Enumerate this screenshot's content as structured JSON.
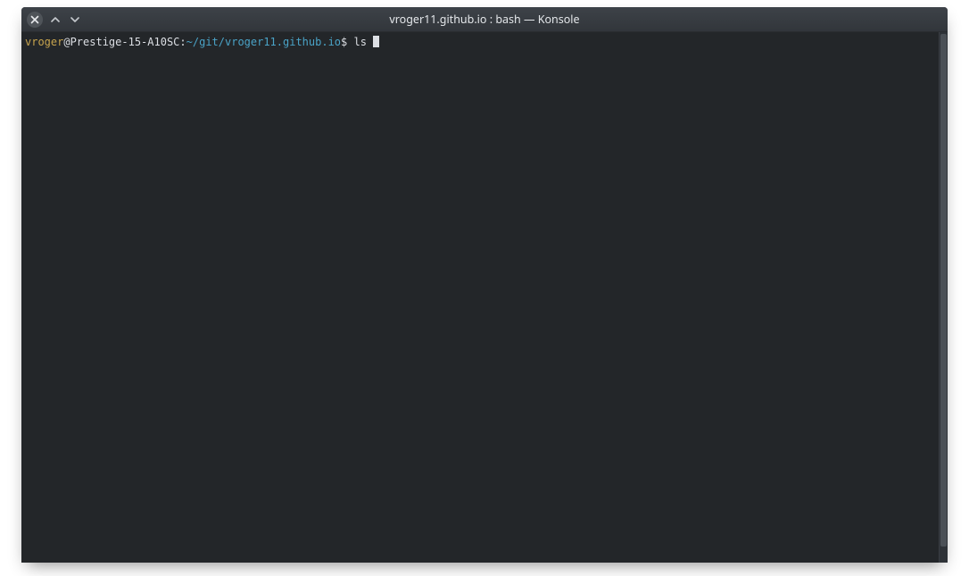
{
  "window": {
    "title": "vroger11.github.io : bash — Konsole"
  },
  "prompt": {
    "user": "vroger",
    "host_sep": "@Prestige-15-A10SC:",
    "path": "~/git/vroger11.github.io",
    "symbol": "$ ",
    "command": "ls "
  }
}
